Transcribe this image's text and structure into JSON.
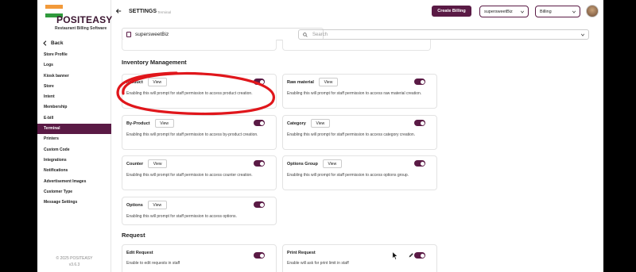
{
  "colors": {
    "brand": "#5a1a45",
    "toggle_on": "#5a1a45",
    "annotation": "#e0161b"
  },
  "sidebar": {
    "brand": "POSITEASY",
    "tagline": "Restaurant Billing Software",
    "back_label": "Back",
    "items": [
      {
        "label": "Store Profile"
      },
      {
        "label": "Logs"
      },
      {
        "label": "Kiosk banner"
      },
      {
        "label": "Store"
      },
      {
        "label": "Intent"
      },
      {
        "label": "Membership"
      },
      {
        "label": "E-bill"
      },
      {
        "label": "Terminal",
        "active": true
      },
      {
        "label": "Printers"
      },
      {
        "label": "Custom Code"
      },
      {
        "label": "Integrations"
      },
      {
        "label": "Notifications"
      },
      {
        "label": "Advertisement Images"
      },
      {
        "label": "Customer Type"
      },
      {
        "label": "Message Settings"
      }
    ],
    "copyright": "© 2025 POSITEASY",
    "version": "v3.6.3"
  },
  "header": {
    "title": "SETTINGS",
    "subtitle": "Terminal",
    "create_billing_label": "Create Billing",
    "store_select_value": "supersweetBiz",
    "mode_select_value": "Billing",
    "back_icon": "arrow-left-icon"
  },
  "store_box": {
    "name": "supersweetBiz",
    "icon": "store-icon"
  },
  "search": {
    "placeholder": "Search",
    "icon": "search-icon"
  },
  "sections": {
    "inventory_title": "Inventory Management",
    "request_title": "Request"
  },
  "inventory_cards": [
    {
      "label": "Product",
      "view": "View",
      "desc": "Enabling this will prompt for staff permission to access product creation.",
      "enabled": true
    },
    {
      "label": "Raw material",
      "view": "View",
      "desc": "Enabling this will prompt for staff permission to access raw material creation.",
      "enabled": true
    },
    {
      "label": "By-Product",
      "view": "View",
      "desc": "Enabling this will prompt for staff permission to access by-product creation.",
      "enabled": true
    },
    {
      "label": "Category",
      "view": "View",
      "desc": "Enabling this will prompt for staff permission to access category creation.",
      "enabled": true
    },
    {
      "label": "Counter",
      "view": "View",
      "desc": "Enabling this will prompt for staff permission to access counter creation.",
      "enabled": true
    },
    {
      "label": "Options Group",
      "view": "View",
      "desc": "Enabling this will prompt for staff permission to access options group.",
      "enabled": true
    },
    {
      "label": "Options",
      "view": "View",
      "desc": "Enabling this will prompt for staff permission to access options.",
      "enabled": true
    }
  ],
  "request_cards": [
    {
      "label": "Edit Request",
      "desc": "Enable to edit requests in staff",
      "enabled": true
    },
    {
      "label": "Print Request",
      "desc": "Enable will ask for print limit in staff",
      "enabled": true
    }
  ]
}
